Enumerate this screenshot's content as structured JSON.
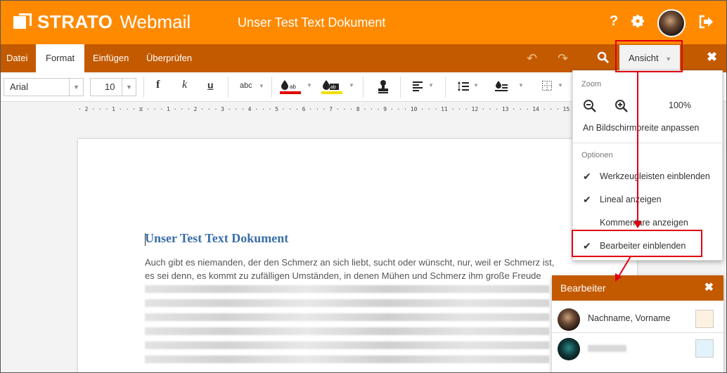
{
  "app": {
    "brand": "STRATO",
    "product": "Webmail",
    "doc_title": "Unser Test Text Dokument"
  },
  "header_icons": {
    "help": "?",
    "settings": "gear-icon",
    "logout": "logout-icon"
  },
  "menubar": {
    "items": [
      "Datei",
      "Format",
      "Einfügen",
      "Überprüfen"
    ],
    "active": "Format",
    "view_label": "Ansicht"
  },
  "toolbar": {
    "font_name": "Arial",
    "font_size": "10",
    "bold": "f",
    "italic": "k",
    "underline": "u",
    "spell": "abc"
  },
  "ruler": {
    "text": "· 2 · · · 1 · · · ⧖ · · · 1 · · · 2 · · · 3 · · · 4 · · · 5 · · · 6 · · · 7 · · · 8 · · · 9 · · · 10 · · · 11 · · · 12 · · · 13 · · · 14 · · · 15 · · · 16 · ·"
  },
  "document": {
    "heading": "Unser Test Text Dokument",
    "para1": "Auch gibt es niemanden, der den Schmerz an sich liebt, sucht oder wünscht, nur, weil er Schmerz ist,",
    "para2": "es sei denn, es kommt zu zufälligen Umständen, in denen Mühen und Schmerz ihm große Freude"
  },
  "view_menu": {
    "zoom_heading": "Zoom",
    "zoom_value": "100%",
    "fit_width": "An Bildschirmbreite anpassen",
    "options_heading": "Optionen",
    "options": [
      {
        "label": "Werkzeugleisten einblenden",
        "checked": true
      },
      {
        "label": "Lineal anzeigen",
        "checked": true
      },
      {
        "label": "Kommentare anzeigen",
        "checked": false
      },
      {
        "label": "Bearbeiter einblenden",
        "checked": true
      }
    ]
  },
  "editors_panel": {
    "title": "Bearbeiter",
    "users": [
      {
        "name": "Nachname, Vorname",
        "color": "#fdf1e1"
      },
      {
        "name": "",
        "color": "#e2f3fb"
      }
    ]
  },
  "colors": {
    "accent": "#ff8a00",
    "menubar": "#c35a00",
    "highlight_box": "#e00010",
    "font_color_bar": "#e00000",
    "highlight_color_bar": "#f0e000"
  }
}
